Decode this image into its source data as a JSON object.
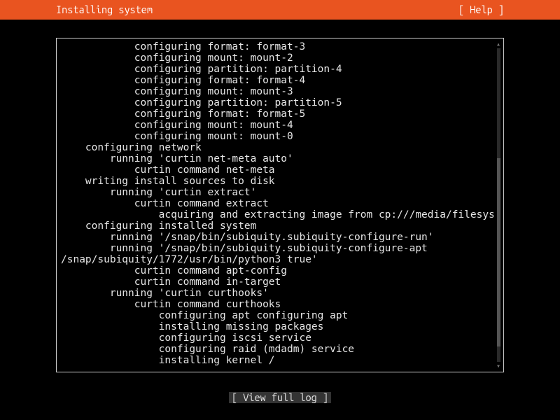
{
  "header": {
    "title": "Installing system",
    "help_label": "[ Help ]"
  },
  "log_lines": [
    {
      "indent": 6,
      "text": "configuring format: format-3"
    },
    {
      "indent": 6,
      "text": "configuring mount: mount-2"
    },
    {
      "indent": 6,
      "text": "configuring partition: partition-4"
    },
    {
      "indent": 6,
      "text": "configuring format: format-4"
    },
    {
      "indent": 6,
      "text": "configuring mount: mount-3"
    },
    {
      "indent": 6,
      "text": "configuring partition: partition-5"
    },
    {
      "indent": 6,
      "text": "configuring format: format-5"
    },
    {
      "indent": 6,
      "text": "configuring mount: mount-4"
    },
    {
      "indent": 6,
      "text": "configuring mount: mount-0"
    },
    {
      "indent": 2,
      "text": "configuring network"
    },
    {
      "indent": 4,
      "text": "running 'curtin net-meta auto'"
    },
    {
      "indent": 6,
      "text": "curtin command net-meta"
    },
    {
      "indent": 2,
      "text": "writing install sources to disk"
    },
    {
      "indent": 4,
      "text": "running 'curtin extract'"
    },
    {
      "indent": 6,
      "text": "curtin command extract"
    },
    {
      "indent": 8,
      "text": "acquiring and extracting image from cp:///media/filesystem"
    },
    {
      "indent": 2,
      "text": "configuring installed system"
    },
    {
      "indent": 4,
      "text": "running '/snap/bin/subiquity.subiquity-configure-run'"
    },
    {
      "indent": 4,
      "text": "running '/snap/bin/subiquity.subiquity-configure-apt"
    },
    {
      "indent": 0,
      "text": "/snap/subiquity/1772/usr/bin/python3 true'"
    },
    {
      "indent": 6,
      "text": "curtin command apt-config"
    },
    {
      "indent": 6,
      "text": "curtin command in-target"
    },
    {
      "indent": 4,
      "text": "running 'curtin curthooks'"
    },
    {
      "indent": 6,
      "text": "curtin command curthooks"
    },
    {
      "indent": 8,
      "text": "configuring apt configuring apt"
    },
    {
      "indent": 8,
      "text": "installing missing packages"
    },
    {
      "indent": 8,
      "text": "configuring iscsi service"
    },
    {
      "indent": 8,
      "text": "configuring raid (mdadm) service"
    },
    {
      "indent": 8,
      "text": "installing kernel /"
    }
  ],
  "footer": {
    "view_full_log": "[ View full log ]"
  },
  "scroll": {
    "up_glyph": "▴",
    "down_glyph": "▾"
  }
}
